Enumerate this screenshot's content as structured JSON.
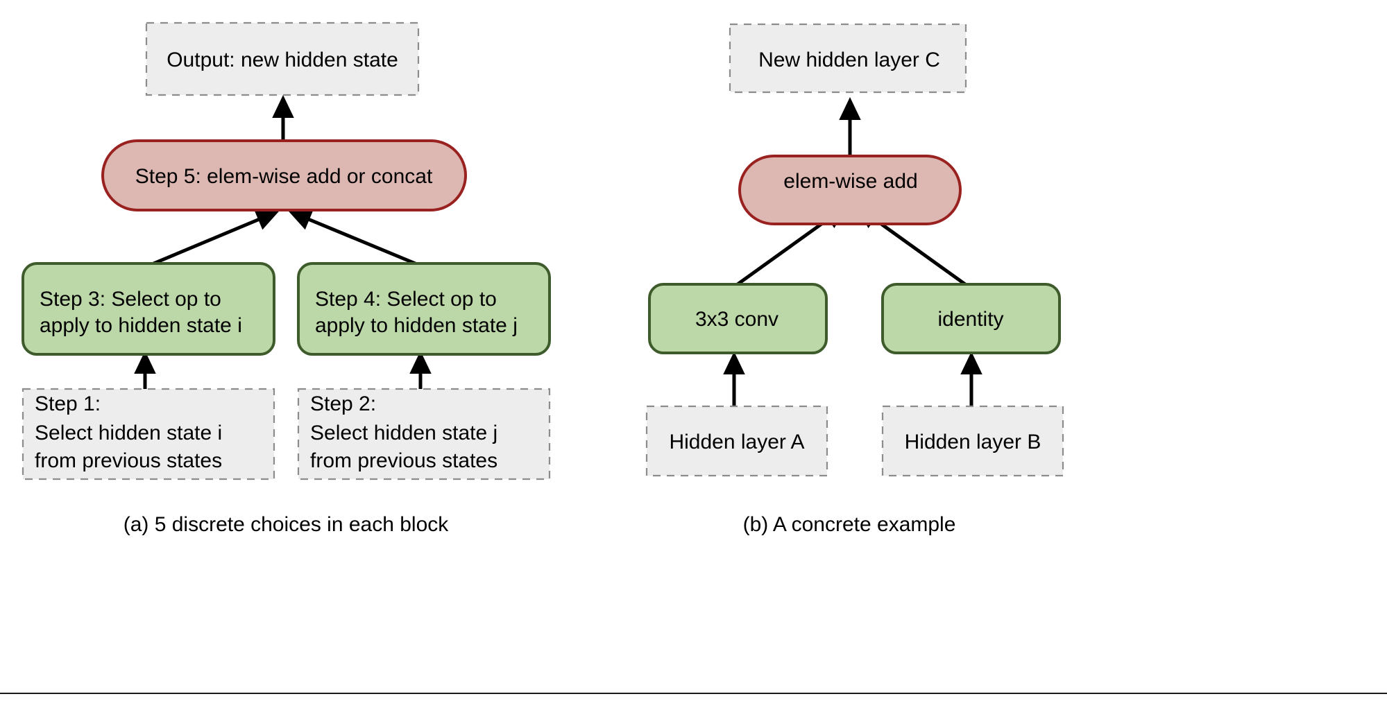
{
  "figure": {
    "background_color": "#ffffff",
    "panels": [
      {
        "id": "panel-a",
        "caption": "(a) 5 discrete choices in each block",
        "nodes": [
          {
            "id": "a-output",
            "kind": "dashed",
            "lines": [
              "Output: new hidden state"
            ],
            "align": "center",
            "fill": "#ededed",
            "stroke": "#8c8c8c"
          },
          {
            "id": "a-step5",
            "kind": "rounded-red",
            "lines": [
              "Step 5: elem-wise add or concat"
            ],
            "align": "center",
            "fill": "#ddb7b1",
            "stroke": "#992120"
          },
          {
            "id": "a-step3",
            "kind": "rounded-green",
            "lines": [
              "Step 3: Select op to",
              "apply to hidden state i"
            ],
            "align": "left",
            "fill": "#bcd7a8",
            "stroke": "#3d5b2b"
          },
          {
            "id": "a-step4",
            "kind": "rounded-green",
            "lines": [
              "Step 4: Select op to",
              "apply to hidden state j"
            ],
            "align": "left",
            "fill": "#bcd7a8",
            "stroke": "#3d5b2b"
          },
          {
            "id": "a-step1",
            "kind": "dashed",
            "lines": [
              "Step 1:",
              "Select hidden state i",
              "from previous states"
            ],
            "align": "left",
            "fill": "#ededed",
            "stroke": "#8c8c8c"
          },
          {
            "id": "a-step2",
            "kind": "dashed",
            "lines": [
              "Step 2:",
              "Select hidden state j",
              "from previous states"
            ],
            "align": "left",
            "fill": "#ededed",
            "stroke": "#8c8c8c"
          }
        ],
        "edges": [
          {
            "from": "a-step5",
            "to": "a-output",
            "style": "straight-up"
          },
          {
            "from": "a-step3",
            "to": "a-step5",
            "style": "diagonal"
          },
          {
            "from": "a-step4",
            "to": "a-step5",
            "style": "diagonal"
          },
          {
            "from": "a-step1",
            "to": "a-step3",
            "style": "straight-up"
          },
          {
            "from": "a-step2",
            "to": "a-step4",
            "style": "straight-up"
          }
        ]
      },
      {
        "id": "panel-b",
        "caption": "(b) A concrete example",
        "nodes": [
          {
            "id": "b-newc",
            "kind": "dashed",
            "lines": [
              "New hidden layer C"
            ],
            "align": "center",
            "fill": "#ededed",
            "stroke": "#8c8c8c"
          },
          {
            "id": "b-add",
            "kind": "rounded-red",
            "lines": [
              "elem-wise add"
            ],
            "align": "center",
            "fill": "#ddb7b1",
            "stroke": "#992120"
          },
          {
            "id": "b-conv",
            "kind": "rounded-green",
            "lines": [
              "3x3 conv"
            ],
            "align": "center",
            "fill": "#bcd7a8",
            "stroke": "#3d5b2b"
          },
          {
            "id": "b-identity",
            "kind": "rounded-green",
            "lines": [
              "identity"
            ],
            "align": "center",
            "fill": "#bcd7a8",
            "stroke": "#3d5b2b"
          },
          {
            "id": "b-layera",
            "kind": "dashed",
            "lines": [
              "Hidden layer A"
            ],
            "align": "center",
            "fill": "#ededed",
            "stroke": "#8c8c8c"
          },
          {
            "id": "b-layerb",
            "kind": "dashed",
            "lines": [
              "Hidden layer B"
            ],
            "align": "center",
            "fill": "#ededed",
            "stroke": "#8c8c8c"
          }
        ],
        "edges": [
          {
            "from": "b-add",
            "to": "b-newc",
            "style": "straight-up"
          },
          {
            "from": "b-conv",
            "to": "b-add",
            "style": "diagonal"
          },
          {
            "from": "b-identity",
            "to": "b-add",
            "style": "diagonal"
          },
          {
            "from": "b-layera",
            "to": "b-conv",
            "style": "straight-up"
          },
          {
            "from": "b-layerb",
            "to": "b-identity",
            "style": "straight-up"
          }
        ]
      }
    ]
  },
  "labels": {
    "a_output": "Output: new hidden state",
    "a_step5": "Step 5: elem-wise add or concat",
    "a_step3_l1": "Step 3: Select op to",
    "a_step3_l2": "apply to hidden state i",
    "a_step4_l1": "Step 4: Select op to",
    "a_step4_l2": "apply to hidden state j",
    "a_step1_l1": "Step 1:",
    "a_step1_l2": "Select hidden state i",
    "a_step1_l3": "from previous states",
    "a_step2_l1": "Step 2:",
    "a_step2_l2": "Select hidden state j",
    "a_step2_l3": "from previous states",
    "caption_a": "(a) 5 discrete choices in each block",
    "b_newc": "New hidden layer C",
    "b_add": "elem-wise add",
    "b_conv": "3x3 conv",
    "b_identity": "identity",
    "b_layera": "Hidden layer A",
    "b_layerb": "Hidden layer B",
    "caption_b": "(b) A concrete example"
  }
}
